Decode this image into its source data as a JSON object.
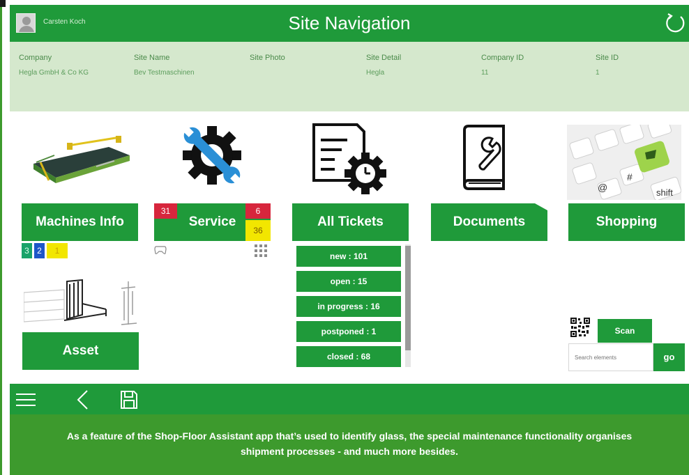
{
  "header": {
    "user_name": "Carsten Koch",
    "title": "Site Navigation"
  },
  "info": {
    "company_label": "Company",
    "company_value": "Hegla GmbH & Co KG",
    "site_name_label": "Site Name",
    "site_name_value": "Bev Testmaschinen",
    "site_photo_label": "Site Photo",
    "site_detail_label": "Site Detail",
    "site_detail_value": "Hegla",
    "company_id_label": "Company ID",
    "company_id_value": "11",
    "site_id_label": "Site ID",
    "site_id_value": "1"
  },
  "tiles": {
    "machines_info": "Machines Info",
    "service": "Service",
    "all_tickets": "All Tickets",
    "documents": "Documents",
    "shopping": "Shopping",
    "asset": "Asset"
  },
  "badges": {
    "machines": [
      "3",
      "2",
      "1"
    ],
    "service_left": "31",
    "service_right_top": "6",
    "service_right_bottom": "36"
  },
  "tickets": [
    {
      "label": "new : 101"
    },
    {
      "label": "open : 15"
    },
    {
      "label": "in progress : 16"
    },
    {
      "label": "postponed : 1"
    },
    {
      "label": "closed : 68"
    }
  ],
  "scan": {
    "scan_label": "Scan",
    "search_placeholder": "Search elements",
    "go_label": "go"
  },
  "caption": {
    "line1": "As a feature of the Shop-Floor Assistant app that’s used to identify glass, the special maintenance functionality organises",
    "line2": "shipment processes - and much more besides."
  },
  "colors": {
    "accent_green": "#1f9a3a",
    "info_panel": "#d5e8cd",
    "badge_red": "#d7263d",
    "badge_yellow": "#f2e600",
    "badge_blue": "#1e56c8",
    "badge_teal": "#1aa36a"
  }
}
